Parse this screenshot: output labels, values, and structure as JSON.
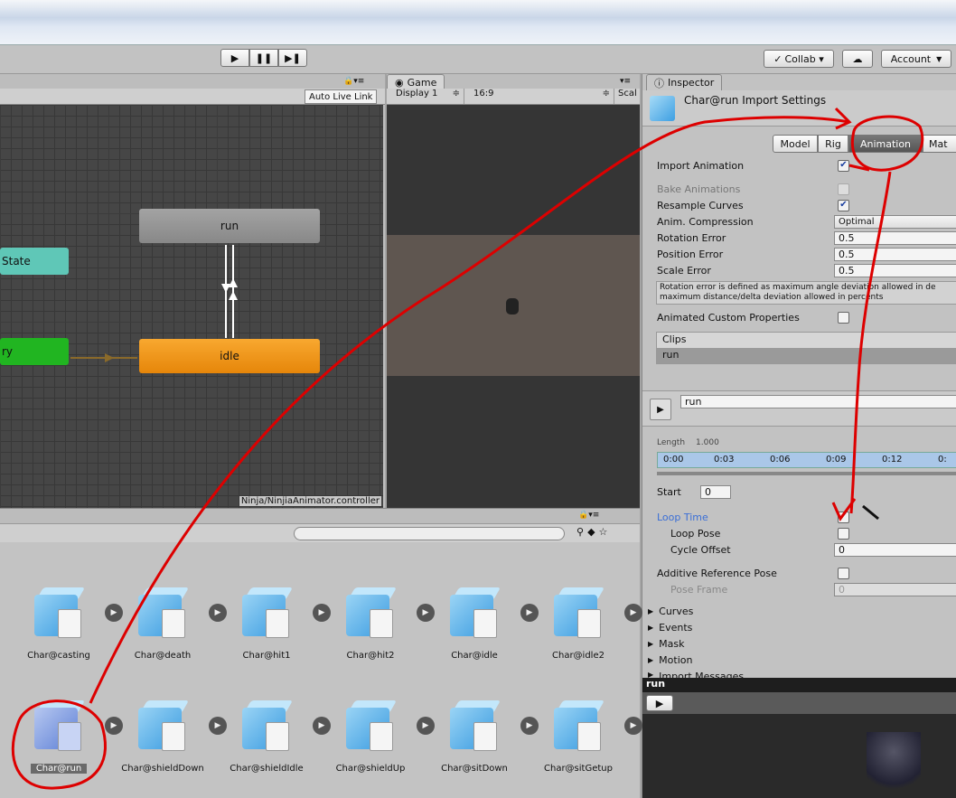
{
  "toolbar": {
    "collab_label": "Collab ▾",
    "account_label": "Account",
    "play_icon": "play-icon",
    "pause_icon": "pause-icon",
    "step_icon": "step-icon"
  },
  "animator": {
    "auto_live_link": "Auto Live Link",
    "nodes": {
      "run": "run",
      "idle": "idle",
      "state": "State",
      "entry": "ry"
    },
    "footer": "Ninja/NinjiaAnimator.controller"
  },
  "game": {
    "tab_label": "Game",
    "display": "Display 1",
    "aspect": "16:9",
    "scale": "Scal"
  },
  "inspector": {
    "tab_label": "Inspector",
    "title": "Char@run Import Settings",
    "tabs": [
      "Model",
      "Rig",
      "Animation",
      "Mat"
    ],
    "import_animation": "Import Animation",
    "bake_animations": "Bake Animations",
    "resample_curves": "Resample Curves",
    "anim_compression": "Anim. Compression",
    "anim_compression_value": "Optimal",
    "rotation_error": "Rotation Error",
    "rotation_error_value": "0.5",
    "position_error": "Position Error",
    "position_error_value": "0.5",
    "scale_error": "Scale Error",
    "scale_error_value": "0.5",
    "help_line1": "Rotation error is defined as maximum angle deviation allowed in de",
    "help_line2": "maximum distance/delta deviation allowed in percents",
    "animated_custom": "Animated Custom Properties",
    "clips_header": "Clips",
    "clip_run": "run",
    "clip_name_value": "run",
    "length_label": "Length",
    "length_value": "1.000",
    "timeline_ticks": [
      "0:00",
      "0:03",
      "0:06",
      "0:09",
      "0:12",
      "0:"
    ],
    "start_label": "Start",
    "start_value": "0",
    "loop_time": "Loop Time",
    "loop_pose": "Loop Pose",
    "cycle_offset": "Cycle Offset",
    "cycle_offset_value": "0",
    "additive_pose": "Additive Reference Pose",
    "pose_frame": "Pose Frame",
    "pose_frame_value": "0",
    "foldouts": [
      "Curves",
      "Events",
      "Mask",
      "Motion",
      "Import Messages"
    ],
    "preview_title": "run"
  },
  "project": {
    "assets_row1": [
      "Char@casting",
      "Char@death",
      "Char@hit1",
      "Char@hit2",
      "Char@idle",
      "Char@idle2"
    ],
    "assets_row2": [
      "Char@run",
      "Char@shieldDown",
      "Char@shieldIdle",
      "Char@shieldUp",
      "Char@sitDown",
      "Char@sitGetup"
    ]
  },
  "colors": {
    "annotation": "#dd0000",
    "selection": "#3b6fd6",
    "idle_node": "#f0900a",
    "run_node": "#8d8d8d",
    "entry_node": "#22b422",
    "state_node": "#5cc8b8"
  }
}
